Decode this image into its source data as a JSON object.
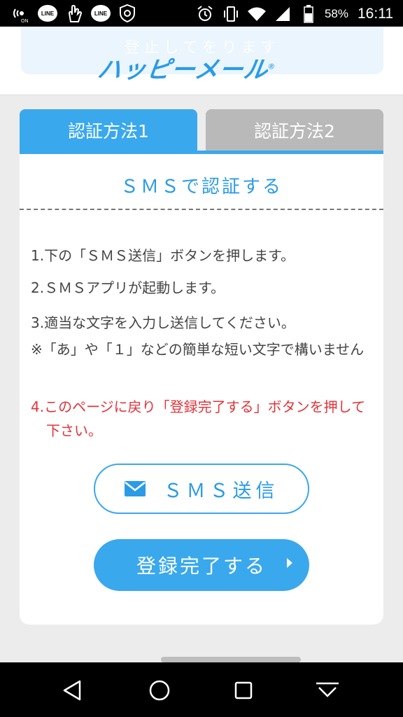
{
  "status_bar": {
    "battery_percent": "58%",
    "time": "16:11",
    "left_icons": [
      "nfc-on-icon",
      "line-app-icon",
      "gesture-icon",
      "line-app-icon",
      "security-shield-icon"
    ],
    "right_icons": [
      "alarm-icon",
      "vibrate-icon",
      "wifi-icon",
      "signal-icon",
      "battery-icon"
    ],
    "line_label": "LINE",
    "nfc_label": "ON"
  },
  "header": {
    "ghost_text": "登止してをります",
    "logo_text": "ハッピーメール",
    "logo_mark": "®"
  },
  "tabs": [
    {
      "label": "認証方法1",
      "active": true
    },
    {
      "label": "認証方法2",
      "active": false
    }
  ],
  "card": {
    "title": "ＳＭＳで認証する",
    "steps": [
      "1.下の「ＳＭＳ送信」ボタンを押します。",
      "2.ＳＭＳアプリが起動します。",
      "3.適当な文字を入力し送信してください。",
      "※「あ」や「１」などの簡単な短い文字で構いません",
      "4.このページに戻り「登録完了する」ボタンを押して下さい。"
    ],
    "sms_button": "ＳＭＳ送信",
    "done_button": "登録完了する"
  },
  "colors": {
    "accent": "#3aa8ec",
    "accent_text": "#2b9be6",
    "warning_red": "#e0343a",
    "inactive_tab": "#b9b9b9"
  }
}
